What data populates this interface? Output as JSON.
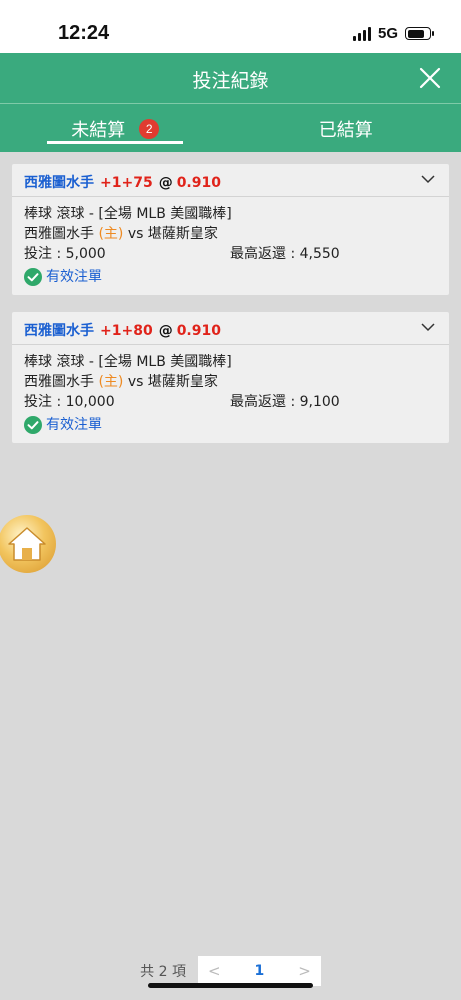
{
  "status_bar": {
    "time": "12:24",
    "network": "5G"
  },
  "header": {
    "title": "投注紀錄"
  },
  "tabs": [
    {
      "label": "未結算",
      "badge": "2",
      "active": true
    },
    {
      "label": "已結算",
      "active": false
    }
  ],
  "bets": [
    {
      "team": "西雅圖水手",
      "handicap": "+1+75",
      "at": "@",
      "odds": "0.910",
      "sport_line": "棒球 滾球 - [全場 MLB 美國職棒]",
      "home_team": "西雅圖水手",
      "home_mark": "(主)",
      "vs": "vs",
      "away_team": "堪薩斯皇家",
      "stake_label": "投注 : 5,000",
      "return_label": "最高返還 : 4,550",
      "status": "有效注單"
    },
    {
      "team": "西雅圖水手",
      "handicap": "+1+80",
      "at": "@",
      "odds": "0.910",
      "sport_line": "棒球 滾球 - [全場 MLB 美國職棒]",
      "home_team": "西雅圖水手",
      "home_mark": "(主)",
      "vs": "vs",
      "away_team": "堪薩斯皇家",
      "stake_label": "投注 : 10,000",
      "return_label": "最高返還 : 9,100",
      "status": "有效注單"
    }
  ],
  "pager": {
    "total": "共 2 項",
    "prev": "<",
    "current": "1",
    "next": ">"
  },
  "colors": {
    "header_green": "#3aaa7e",
    "team_blue": "#1a5fd1",
    "odds_red": "#e0231a",
    "badge_red": "#e03b30"
  },
  "icons": [
    "close-icon",
    "chevron-down-icon",
    "check-circle-icon",
    "home-icon"
  ]
}
